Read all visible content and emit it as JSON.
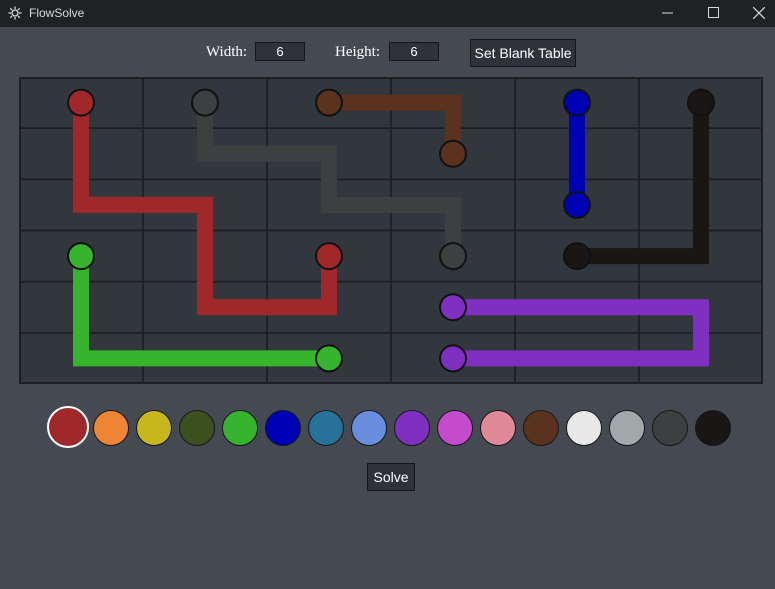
{
  "window": {
    "title": "FlowSolve"
  },
  "controls": {
    "width_label": "Width:",
    "width_value": "6",
    "height_label": "Height:",
    "height_value": "6",
    "set_blank_label": "Set Blank Table"
  },
  "grid": {
    "rows": 6,
    "cols": 6,
    "cell_color": "#32363d",
    "line_color": "#1d1f23",
    "paths": [
      {
        "color": "red",
        "hex": "#a0282a",
        "cells": [
          [
            0,
            0
          ],
          [
            1,
            0
          ],
          [
            2,
            0
          ],
          [
            2,
            1
          ],
          [
            3,
            1
          ],
          [
            4,
            1
          ],
          [
            4,
            2
          ],
          [
            3,
            2
          ]
        ]
      },
      {
        "color": "dark-gray",
        "hex": "#3e3f41",
        "cells": [
          [
            0,
            1
          ],
          [
            1,
            1
          ],
          [
            1,
            2
          ],
          [
            2,
            2
          ],
          [
            2,
            3
          ],
          [
            3,
            3
          ]
        ]
      },
      {
        "color": "brown",
        "hex": "#5a321d",
        "cells": [
          [
            0,
            2
          ],
          [
            0,
            3
          ],
          [
            1,
            3
          ]
        ]
      },
      {
        "color": "blue",
        "hex": "#0000b4",
        "cells": [
          [
            0,
            4
          ],
          [
            1,
            4
          ],
          [
            2,
            4
          ]
        ]
      },
      {
        "color": "black",
        "hex": "#1a1616",
        "cells": [
          [
            0,
            5
          ],
          [
            1,
            5
          ],
          [
            2,
            5
          ],
          [
            3,
            5
          ],
          [
            3,
            4
          ]
        ]
      },
      {
        "color": "green",
        "hex": "#36b42d",
        "cells": [
          [
            3,
            0
          ],
          [
            4,
            0
          ],
          [
            5,
            0
          ],
          [
            5,
            1
          ],
          [
            5,
            2
          ]
        ]
      },
      {
        "color": "purple",
        "hex": "#7f30c0",
        "cells": [
          [
            4,
            3
          ],
          [
            4,
            4
          ],
          [
            4,
            5
          ],
          [
            5,
            5
          ],
          [
            5,
            4
          ],
          [
            5,
            3
          ]
        ]
      }
    ]
  },
  "palette": {
    "selected": "red",
    "colors": [
      {
        "name": "red",
        "hex": "#a0282a"
      },
      {
        "name": "orange",
        "hex": "#ee8436"
      },
      {
        "name": "yellow",
        "hex": "#c7b71c"
      },
      {
        "name": "olive",
        "hex": "#3c4f1e"
      },
      {
        "name": "green",
        "hex": "#36b42d"
      },
      {
        "name": "blue",
        "hex": "#0000b4"
      },
      {
        "name": "teal",
        "hex": "#28719b"
      },
      {
        "name": "light-blue",
        "hex": "#6a8ede"
      },
      {
        "name": "purple",
        "hex": "#7f30c0"
      },
      {
        "name": "magenta",
        "hex": "#c44bcc"
      },
      {
        "name": "pink",
        "hex": "#de8898"
      },
      {
        "name": "brown",
        "hex": "#5a321d"
      },
      {
        "name": "white",
        "hex": "#e8e8e8"
      },
      {
        "name": "gray",
        "hex": "#a3a8aa"
      },
      {
        "name": "dark-gray",
        "hex": "#3e3f41"
      },
      {
        "name": "black",
        "hex": "#1a1616"
      }
    ]
  },
  "actions": {
    "solve_label": "Solve"
  }
}
